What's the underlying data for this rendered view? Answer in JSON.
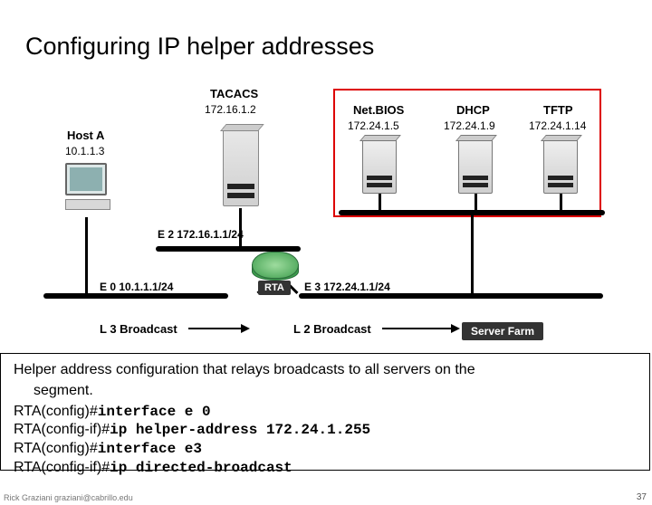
{
  "title": "Configuring IP helper addresses",
  "tacacs": {
    "name": "TACACS",
    "ip": "172.16.1.2"
  },
  "host": {
    "name": "Host A",
    "ip": "10.1.1.3"
  },
  "servers": {
    "netbios": {
      "name": "Net.BIOS",
      "ip": "172.24.1.5"
    },
    "dhcp": {
      "name": "DHCP",
      "ip": "172.24.1.9"
    },
    "tftp": {
      "name": "TFTP",
      "ip": "172.24.1.14"
    }
  },
  "interfaces": {
    "e2": "E 2  172.16.1.1/24",
    "e0": "E 0  10.1.1.1/24",
    "e3": "E 3  172.24.1.1/24"
  },
  "router_label": "RTA",
  "server_farm_label": "Server Farm",
  "broadcast": {
    "l3": "L 3 Broadcast",
    "l2": "L 2 Broadcast"
  },
  "config": {
    "desc_line1": "Helper address configuration that relays broadcasts to all servers on the",
    "desc_line2": "segment.",
    "lines": [
      {
        "prompt": "RTA(config)#",
        "cmd": "interface e 0"
      },
      {
        "prompt": "RTA(config-if)#",
        "cmd": "ip helper-address 172.24.1.255"
      },
      {
        "prompt": "RTA(config)#",
        "cmd": "interface e3"
      },
      {
        "prompt": "RTA(config-if)#",
        "cmd": "ip directed-broadcast"
      }
    ]
  },
  "footer": "Rick Graziani  graziani@cabrillo.edu",
  "page": "37"
}
